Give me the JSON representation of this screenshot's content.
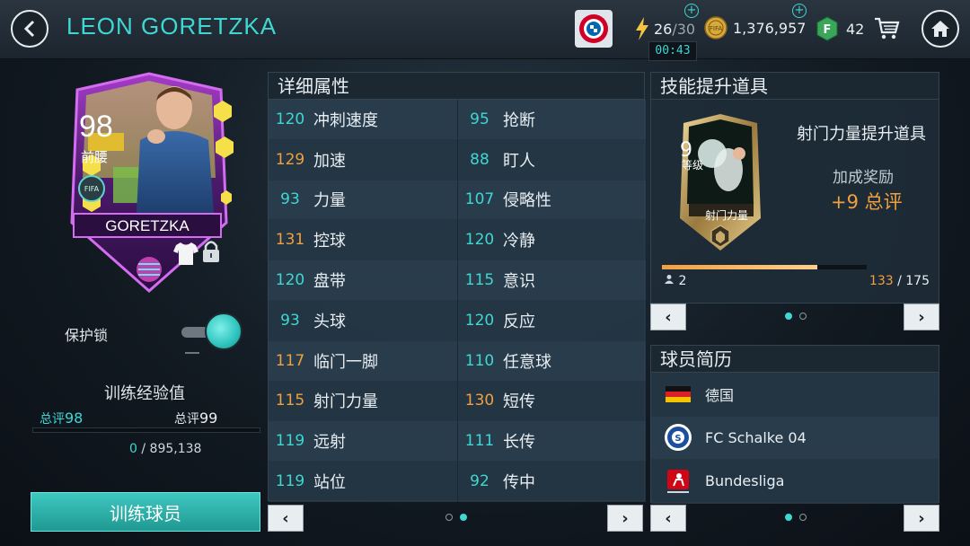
{
  "header": {
    "player_name": "LEON GORETZKA",
    "energy": "26",
    "energy_max": "/30",
    "timer": "00:43",
    "coins": "1,376,957",
    "fifa_points": "42"
  },
  "card": {
    "rating": "98",
    "position": "前腰",
    "name": "GORETZKA"
  },
  "protect_lock": {
    "label": "保护锁"
  },
  "training": {
    "title": "训练经验值",
    "from_label": "总评",
    "from_value": "98",
    "to_label": "总评",
    "to_value": "99",
    "progress": 0,
    "exp_current": "0",
    "exp_sep": " / ",
    "exp_total": "895,138",
    "button_label": "训练球员"
  },
  "attributes": {
    "title": "详细属性",
    "left": [
      {
        "value": "120",
        "name": "冲刺速度",
        "high": false
      },
      {
        "value": "129",
        "name": "加速",
        "high": true
      },
      {
        "value": "93",
        "name": "力量",
        "high": false
      },
      {
        "value": "131",
        "name": "控球",
        "high": true
      },
      {
        "value": "120",
        "name": "盘带",
        "high": false
      },
      {
        "value": "93",
        "name": "头球",
        "high": false
      },
      {
        "value": "117",
        "name": "临门一脚",
        "high": true
      },
      {
        "value": "115",
        "name": "射门力量",
        "high": true
      },
      {
        "value": "119",
        "name": "远射",
        "high": false
      },
      {
        "value": "119",
        "name": "站位",
        "high": false
      }
    ],
    "right": [
      {
        "value": "95",
        "name": "抢断",
        "high": false
      },
      {
        "value": "88",
        "name": "盯人",
        "high": false
      },
      {
        "value": "107",
        "name": "侵略性",
        "high": false
      },
      {
        "value": "120",
        "name": "冷静",
        "high": false
      },
      {
        "value": "115",
        "name": "意识",
        "high": false
      },
      {
        "value": "120",
        "name": "反应",
        "high": false
      },
      {
        "value": "110",
        "name": "任意球",
        "high": false
      },
      {
        "value": "130",
        "name": "短传",
        "high": true
      },
      {
        "value": "111",
        "name": "长传",
        "high": false
      },
      {
        "value": "92",
        "name": "传中",
        "high": false
      }
    ],
    "page": 2,
    "pages": 2
  },
  "boost": {
    "title": "技能提升道具",
    "item_name": "射门力量提升道具",
    "level": "9",
    "level_label": "等级",
    "card_label": "射门力量",
    "bonus_title": "加成奖励",
    "bonus_value": "+9 总评",
    "owned": "2",
    "progress_current": "133",
    "progress_sep": " / ",
    "progress_total": "175",
    "page": 1,
    "pages": 2
  },
  "history": {
    "title": "球员简历",
    "items": [
      {
        "icon": "germany-flag-icon",
        "text": "德国"
      },
      {
        "icon": "schalke-badge-icon",
        "text": "FC Schalke 04"
      },
      {
        "icon": "bundesliga-logo-icon",
        "text": "Bundesliga"
      }
    ],
    "page": 1,
    "pages": 2
  },
  "colors": {
    "accent": "#3fd7d2",
    "highlight": "#f0a040",
    "panel": "#1e2c38"
  }
}
